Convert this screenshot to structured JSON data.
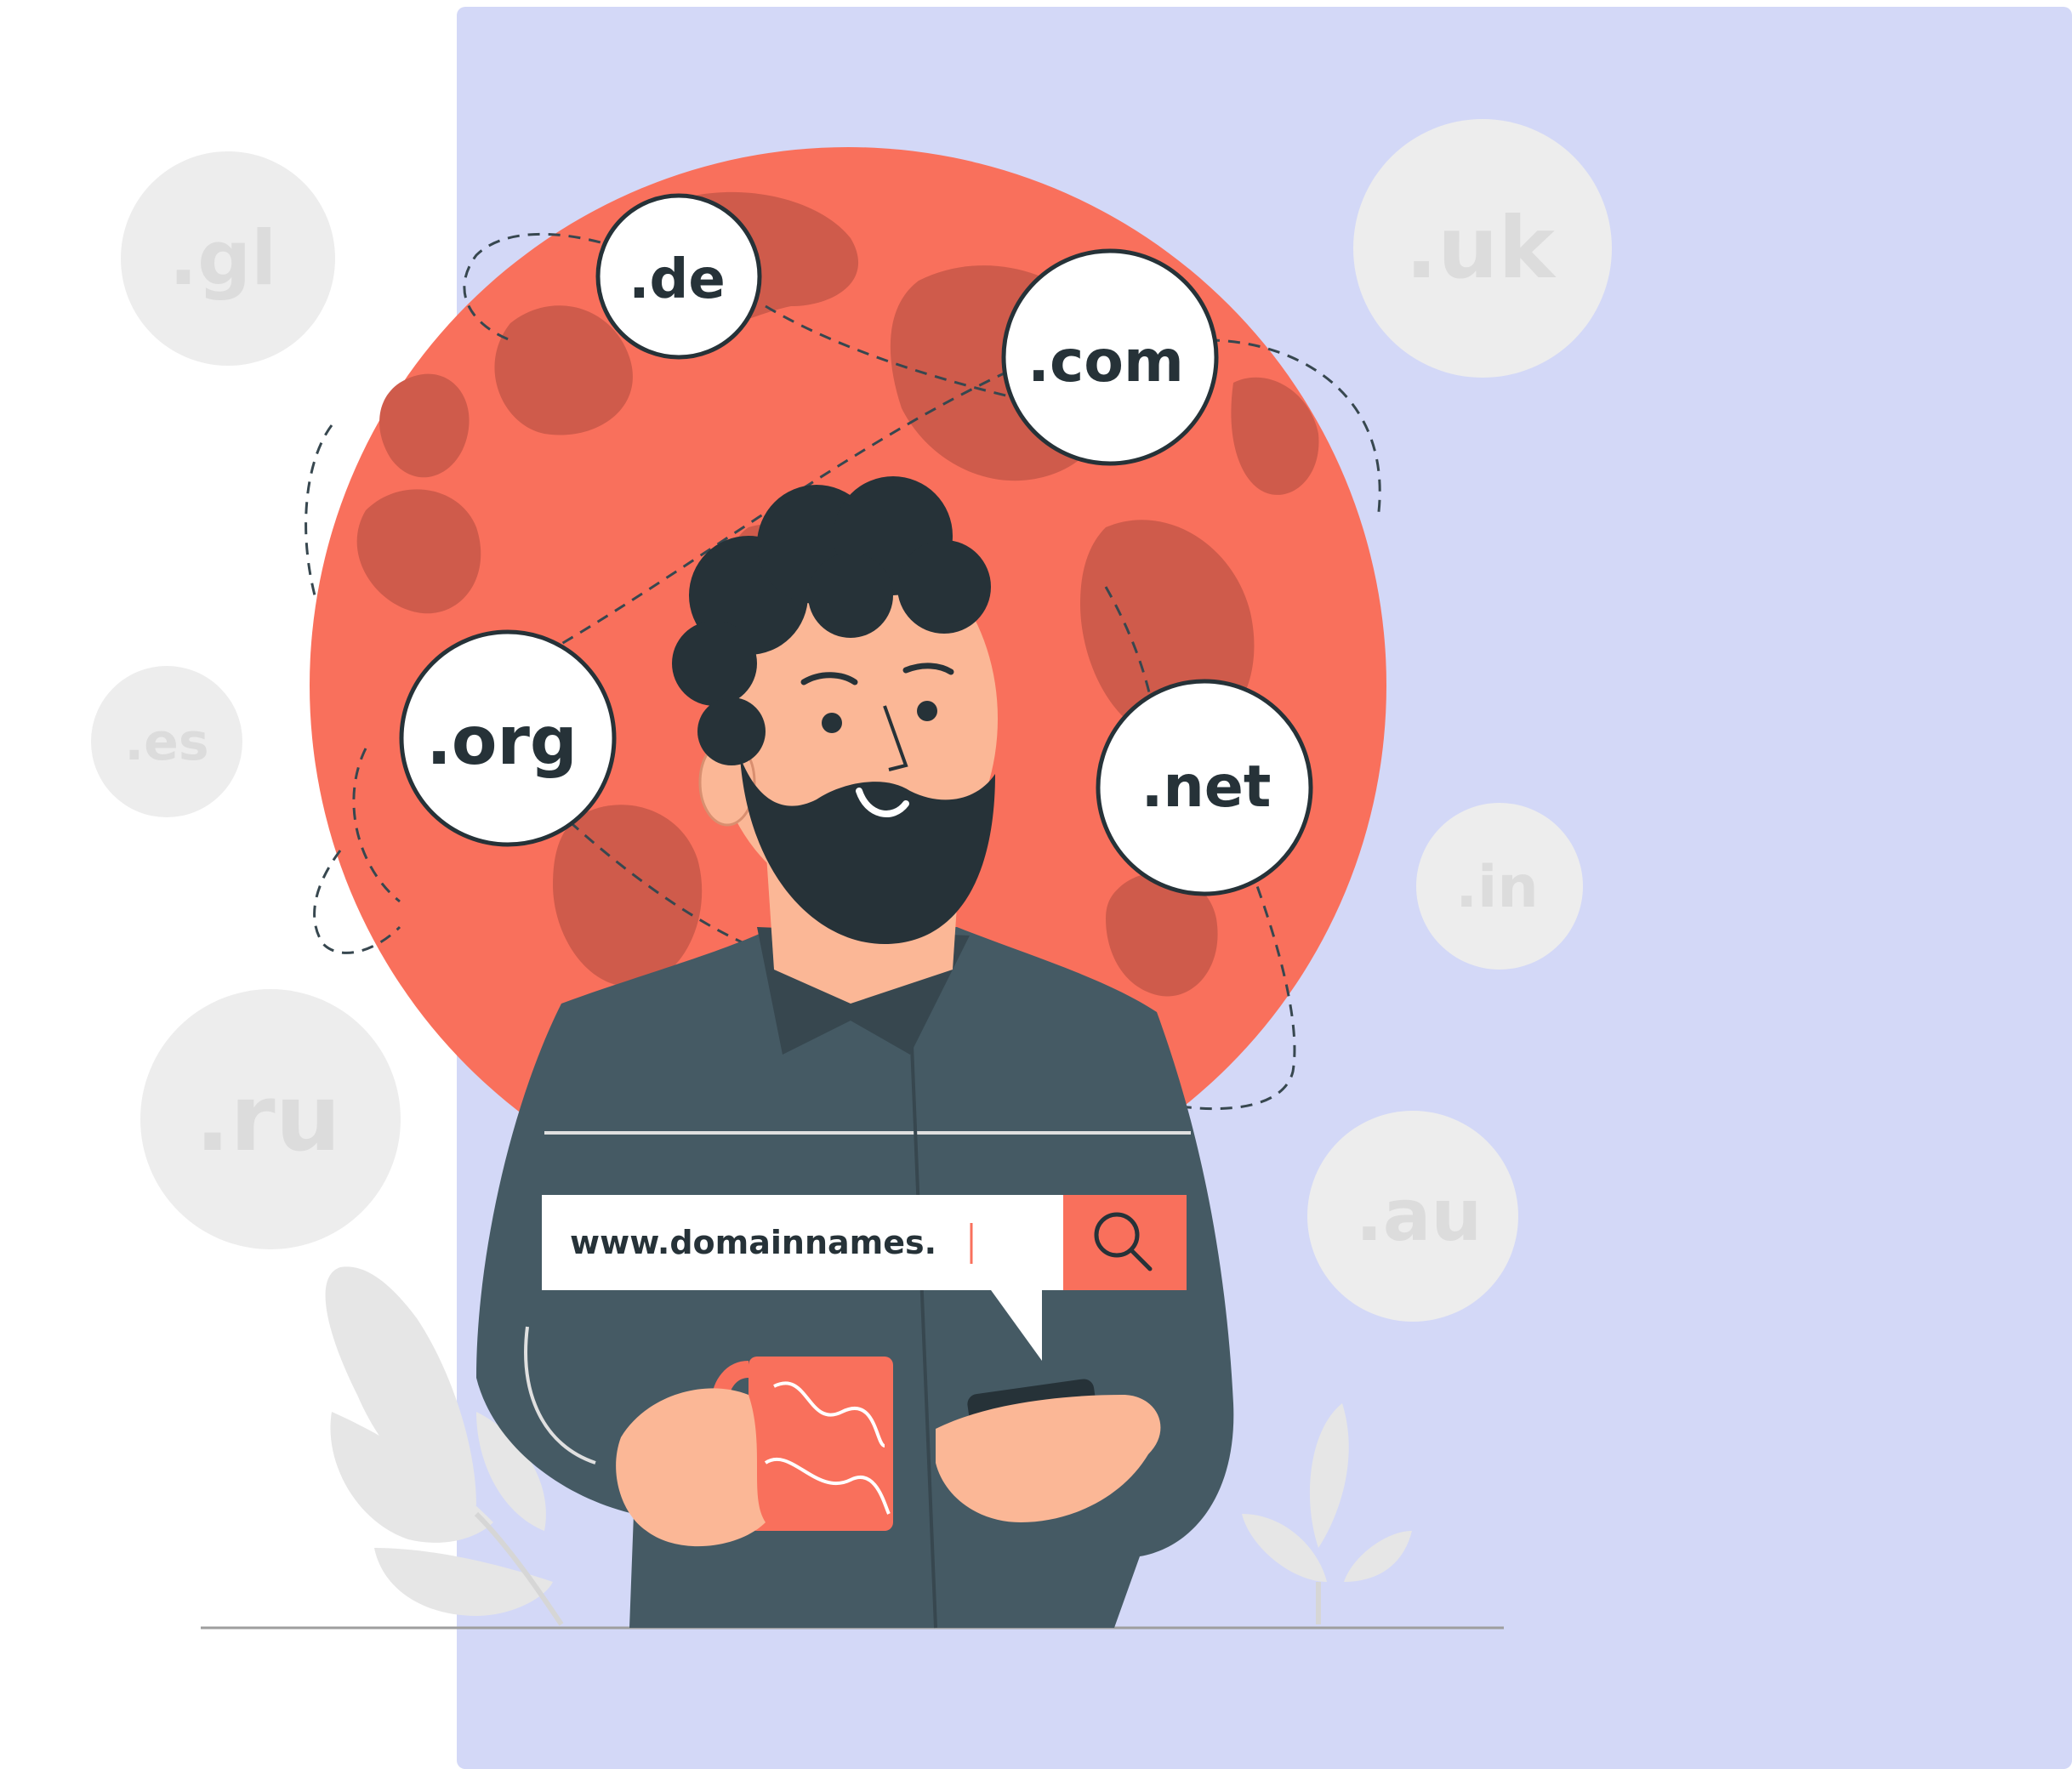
{
  "colors": {
    "panel": "#d3d8f7",
    "globe": "#f9705c",
    "globe_land": "#cf5b4b",
    "bubble_faded": "#ededed",
    "bubble_faded_text": "#dcdcdc",
    "bubble_fg": "#ffffff",
    "ink": "#263238",
    "shirt": "#455a64",
    "skin": "#fbb796",
    "accent": "#f9705c",
    "plant": "#e0e0e0"
  },
  "faded_tlds": {
    "gl": ".gl",
    "es": ".es",
    "ru": ".ru",
    "uk": ".uk",
    "in": ".in",
    "au": ".au"
  },
  "tlds": {
    "de": ".de",
    "com": ".com",
    "org": ".org",
    "net": ".net"
  },
  "search": {
    "value": "www.domainnames.",
    "button_icon": "search-icon"
  }
}
